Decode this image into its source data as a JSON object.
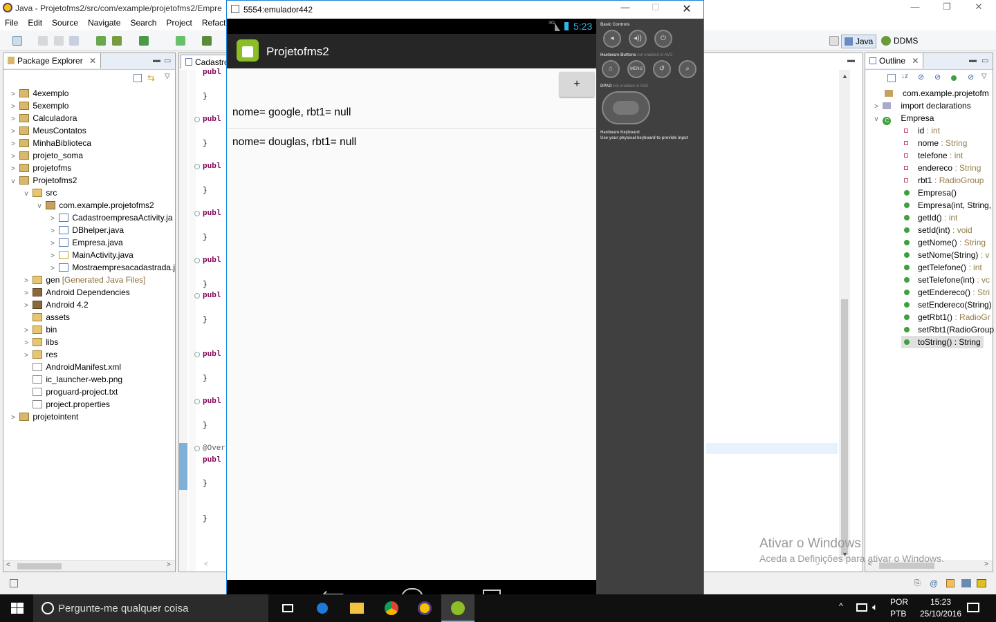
{
  "eclipse": {
    "title": "Java - Projetofms2/src/com/example/projetofms2/Empre",
    "menu": [
      "File",
      "Edit",
      "Source",
      "Navigate",
      "Search",
      "Project",
      "Refactor"
    ],
    "perspectives": {
      "java": "Java",
      "ddms": "DDMS"
    }
  },
  "package_explorer": {
    "title": "Package Explorer",
    "items": [
      {
        "label": "4exemplo"
      },
      {
        "label": "5exemplo"
      },
      {
        "label": "Calculadora"
      },
      {
        "label": "MeusContatos"
      },
      {
        "label": "MinhaBiblioteca"
      },
      {
        "label": "projeto_soma"
      },
      {
        "label": "projetofms"
      },
      {
        "label": "Projetofms2"
      },
      {
        "label": "src"
      },
      {
        "label": "com.example.projetofms2"
      },
      {
        "label": "CadastroempresaActivity.ja"
      },
      {
        "label": "DBhelper.java"
      },
      {
        "label": "Empresa.java"
      },
      {
        "label": "MainActivity.java"
      },
      {
        "label": "Mostraempresacadastrada.j"
      },
      {
        "label": "gen",
        "extra": "[Generated Java Files]"
      },
      {
        "label": "Android Dependencies"
      },
      {
        "label": "Android 4.2"
      },
      {
        "label": "assets"
      },
      {
        "label": "bin"
      },
      {
        "label": "libs"
      },
      {
        "label": "res"
      },
      {
        "label": "AndroidManifest.xml"
      },
      {
        "label": "ic_launcher-web.png"
      },
      {
        "label": "proguard-project.txt"
      },
      {
        "label": "project.properties"
      },
      {
        "label": "projetointent"
      }
    ]
  },
  "editor": {
    "tab": "Cadastro",
    "keyword": "publ",
    "annotation": "@Over",
    "brace": "}"
  },
  "outline": {
    "title": "Outline",
    "package": "com.example.projetofm",
    "imports": "import declarations",
    "class": "Empresa",
    "members": [
      {
        "name": "id",
        "type": " : int"
      },
      {
        "name": "nome",
        "type": " : String"
      },
      {
        "name": "telefone",
        "type": " : int"
      },
      {
        "name": "endereco",
        "type": " : String"
      },
      {
        "name": "rbt1",
        "type": " : RadioGroup"
      },
      {
        "name": "Empresa()",
        "type": ""
      },
      {
        "name": "Empresa(int, String,",
        "type": ""
      },
      {
        "name": "getId()",
        "type": " : int"
      },
      {
        "name": "setId(int)",
        "type": " : void"
      },
      {
        "name": "getNome()",
        "type": " : String"
      },
      {
        "name": "setNome(String)",
        "type": " : v"
      },
      {
        "name": "getTelefone()",
        "type": " : int"
      },
      {
        "name": "setTelefone(int)",
        "type": " : vc"
      },
      {
        "name": "getEndereco()",
        "type": " : Stri"
      },
      {
        "name": "setEndereco(String)",
        "type": ""
      },
      {
        "name": "getRbt1()",
        "type": " : RadioGr"
      },
      {
        "name": "setRbt1(RadioGroup",
        "type": ""
      },
      {
        "name": "toString()",
        "type": " : String"
      }
    ]
  },
  "watermark": {
    "line1": "Ativar o Windows",
    "line2": "Aceda a Definições para ativar o Windows."
  },
  "emulator": {
    "window_title": "5554:emulador442",
    "status_time": "5:23",
    "signal": "3G",
    "app_title": "Projetofms2",
    "add_button": "+",
    "rows": [
      "nome= google, rbt1= null",
      "nome= douglas, rbt1= null"
    ],
    "side": {
      "basic_controls": "Basic Controls",
      "hw_buttons": "Hardware Buttons",
      "hw_buttons_note": "not enabled in AVD",
      "menu_label": "MENU",
      "dpad": "DPAD",
      "dpad_note": "not enabled in AVD",
      "hw_keyboard": "Hardware Keyboard",
      "hw_keyboard_note": "Use your physical keyboard to provide input"
    }
  },
  "taskbar": {
    "search_placeholder": "Pergunte-me qualquer coisa",
    "lang": "POR",
    "layout": "PTB",
    "time": "15:23",
    "date": "25/10/2016"
  }
}
